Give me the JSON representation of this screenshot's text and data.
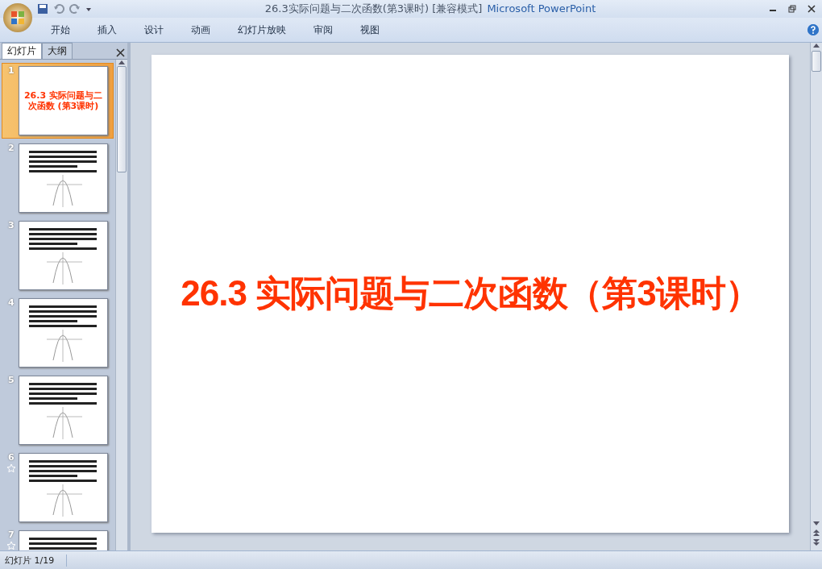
{
  "window": {
    "title": "26.3实际问题与二次函数(第3课时) [兼容模式]",
    "app_name": "Microsoft PowerPoint"
  },
  "ribbon_tabs": [
    {
      "label": "开始",
      "selected": false
    },
    {
      "label": "插入",
      "selected": false
    },
    {
      "label": "设计",
      "selected": false
    },
    {
      "label": "动画",
      "selected": false
    },
    {
      "label": "幻灯片放映",
      "selected": false
    },
    {
      "label": "审阅",
      "selected": false
    },
    {
      "label": "视图",
      "selected": false
    }
  ],
  "panel_tabs": [
    {
      "label": "幻灯片",
      "selected": true
    },
    {
      "label": "大纲",
      "selected": false
    }
  ],
  "slides": [
    {
      "number": "1",
      "selected": true,
      "animated": false,
      "kind": "title",
      "title": "26.3 实际问题与二次函数 (第3课时)"
    },
    {
      "number": "2",
      "selected": false,
      "animated": false,
      "kind": "graph"
    },
    {
      "number": "3",
      "selected": false,
      "animated": false,
      "kind": "graph"
    },
    {
      "number": "4",
      "selected": false,
      "animated": false,
      "kind": "graph"
    },
    {
      "number": "5",
      "selected": false,
      "animated": false,
      "kind": "graph"
    },
    {
      "number": "6",
      "selected": false,
      "animated": true,
      "kind": "graph"
    },
    {
      "number": "7",
      "selected": false,
      "animated": true,
      "kind": "graph"
    }
  ],
  "current_slide": {
    "title": "26.3 实际问题与二次函数（第3课时）"
  },
  "status_bar": {
    "slide_info": "幻灯片 1/19"
  }
}
